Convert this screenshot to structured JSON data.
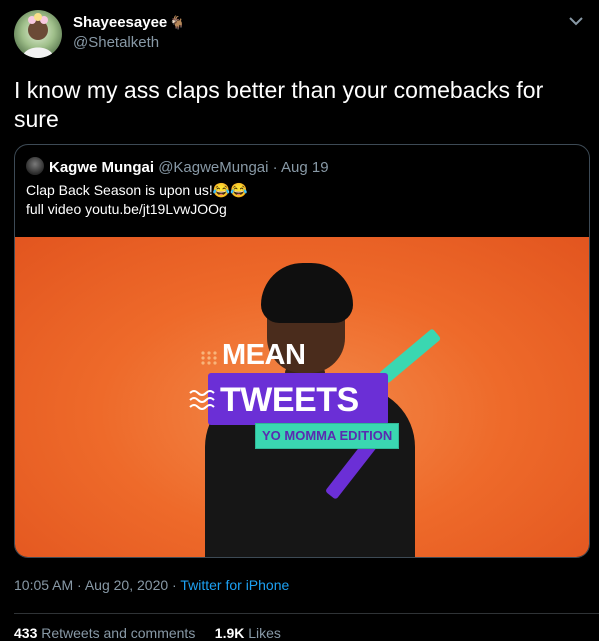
{
  "author": {
    "display_name": "Shayeesayee",
    "name_emoji": "🐐",
    "handle": "@Shetalketh"
  },
  "tweet": {
    "text": "I know my ass claps better than your comebacks for sure"
  },
  "quoted_tweet": {
    "display_name": "Kagwe Mungai",
    "handle": "@KagweMungai",
    "date": "Aug 19",
    "text_line1": "Clap Back Season is upon us!😂😂",
    "text_line2": "full video youtu.be/jt19LvwJOOg",
    "media": {
      "title_top": "MEAN",
      "title_main": "TWEETS",
      "subtitle": "YO MOMMA EDITION"
    }
  },
  "meta": {
    "time": "10:05 AM",
    "date": "Aug 20, 2020",
    "source": "Twitter for iPhone"
  },
  "stats": {
    "retweets_count": "433",
    "retweets_label": "Retweets and comments",
    "likes_count": "1.9K",
    "likes_label": "Likes"
  },
  "colors": {
    "background": "#000000",
    "link": "#1da1f2",
    "muted": "#8899a6",
    "media_orange": "#ee6a2a",
    "media_purple": "#6b2fd6",
    "media_teal": "#3ad7b1"
  },
  "icons": [
    "chevron-down-icon",
    "avatar",
    "waves-icon",
    "dots-icon"
  ]
}
